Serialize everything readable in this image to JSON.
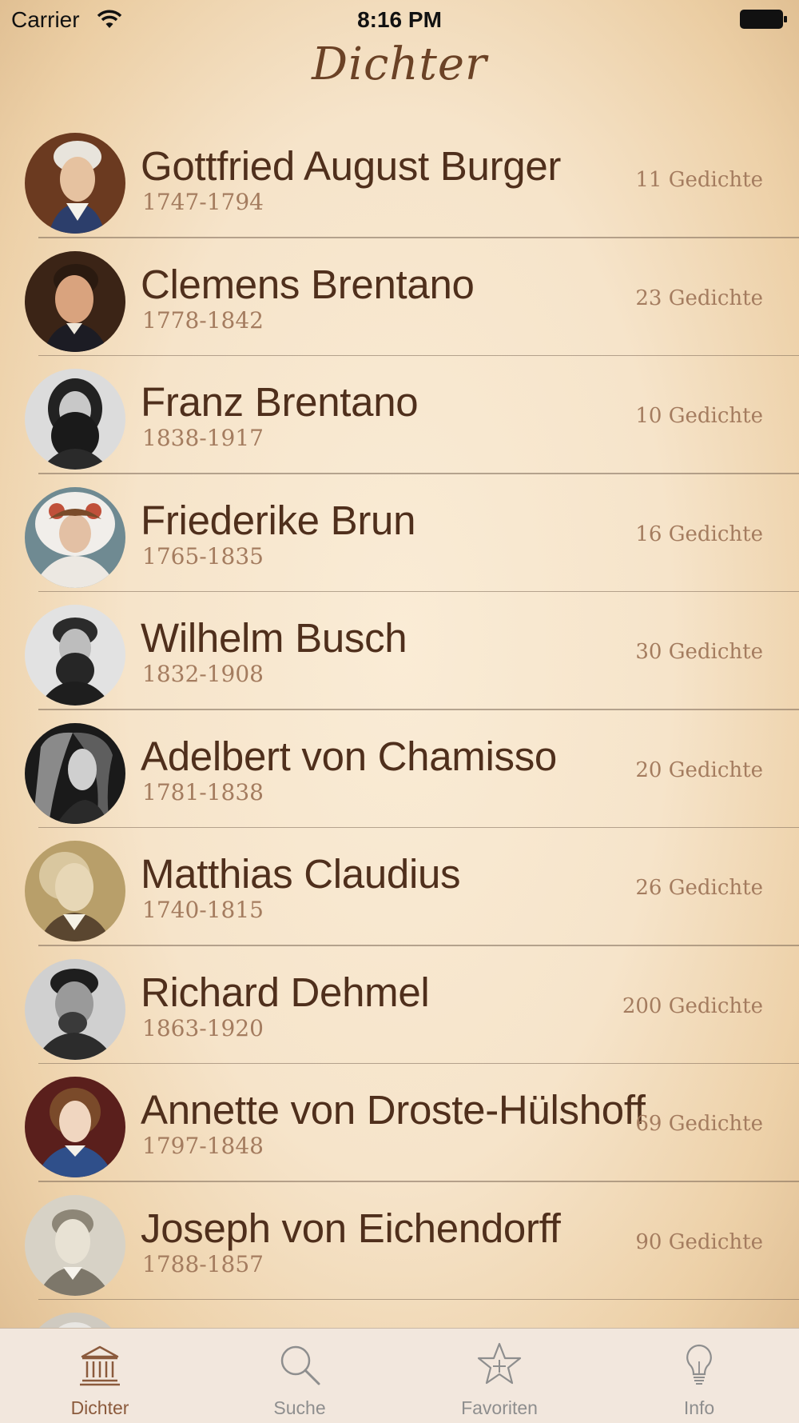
{
  "status_bar": {
    "carrier": "Carrier",
    "time": "8:16 PM"
  },
  "nav": {
    "title": "Dichter"
  },
  "poets": [
    {
      "name": "Gottfried August Burger",
      "years": "1747-1794",
      "count": "11 Gedichte"
    },
    {
      "name": "Clemens Brentano",
      "years": "1778-1842",
      "count": "23 Gedichte"
    },
    {
      "name": "Franz Brentano",
      "years": "1838-1917",
      "count": "10 Gedichte"
    },
    {
      "name": "Friederike Brun",
      "years": "1765-1835",
      "count": "16 Gedichte"
    },
    {
      "name": "Wilhelm Busch",
      "years": "1832-1908",
      "count": "30 Gedichte"
    },
    {
      "name": "Adelbert von Chamisso",
      "years": "1781-1838",
      "count": "20 Gedichte"
    },
    {
      "name": "Matthias Claudius",
      "years": "1740-1815",
      "count": "26 Gedichte"
    },
    {
      "name": "Richard Dehmel",
      "years": "1863-1920",
      "count": "200 Gedichte"
    },
    {
      "name": "Annette von Droste-Hülshoff",
      "years": "1797-1848",
      "count": "69 Gedichte"
    },
    {
      "name": "Joseph von Eichendorff",
      "years": "1788-1857",
      "count": "90 Gedichte"
    }
  ],
  "tabs": [
    {
      "label": "Dichter",
      "icon": "library-icon",
      "active": true
    },
    {
      "label": "Suche",
      "icon": "search-icon",
      "active": false
    },
    {
      "label": "Favoriten",
      "icon": "star-icon",
      "active": false
    },
    {
      "label": "Info",
      "icon": "lightbulb-icon",
      "active": false
    }
  ],
  "colors": {
    "title": "#6b4226",
    "name_text": "#4f2f1c",
    "secondary_text": "#a47c5f",
    "tab_active": "#8b5a3c",
    "tab_inactive": "#8e8e8e"
  }
}
